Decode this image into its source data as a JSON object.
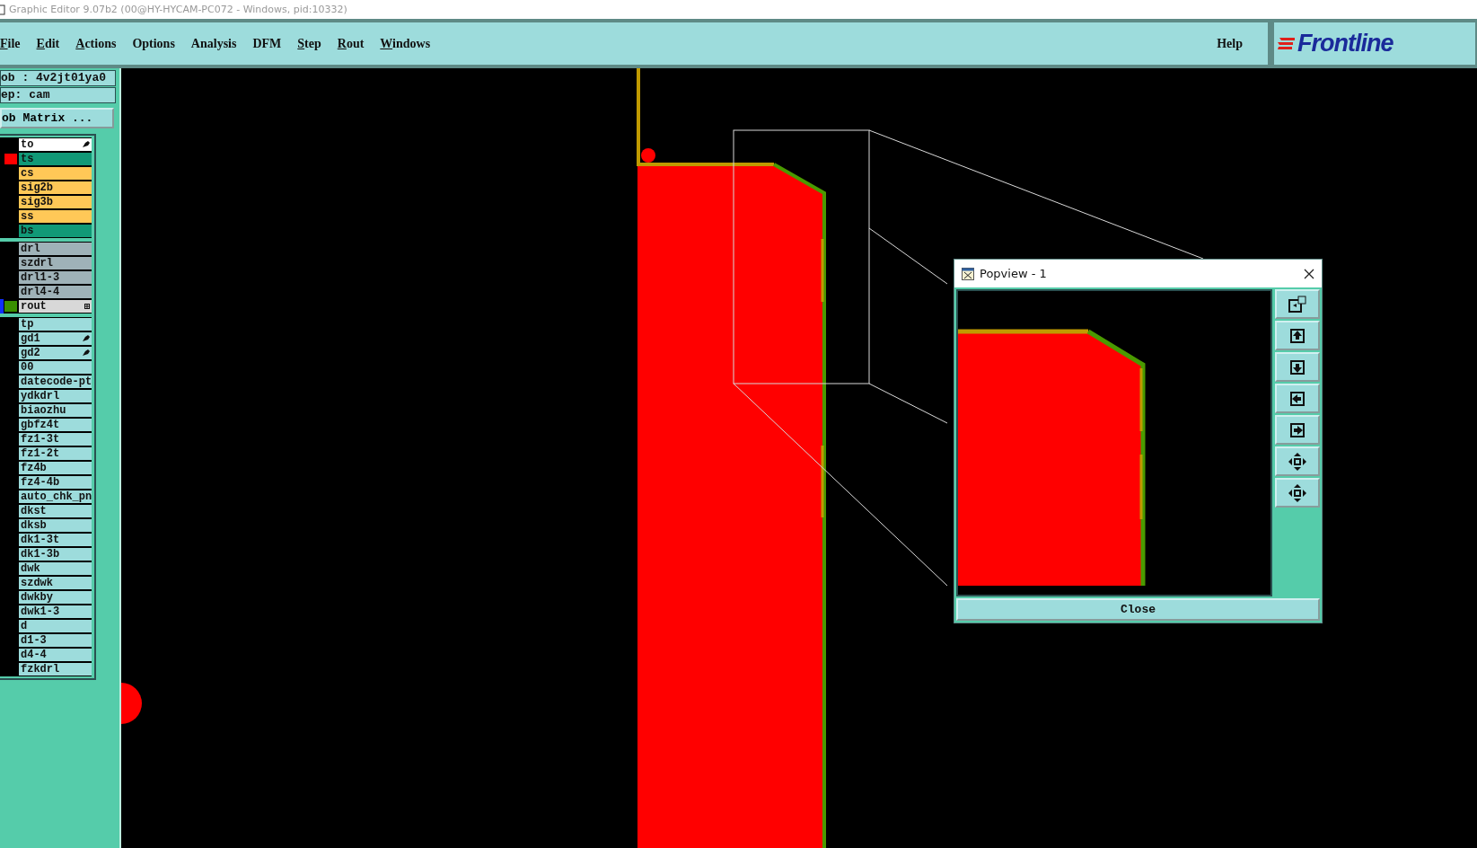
{
  "window": {
    "title": "Graphic Editor 9.07b2 (00@HY-HYCAM-PC072 - Windows, pid:10332)"
  },
  "menu": [
    {
      "label": "File",
      "underlined": true
    },
    {
      "label": "Edit",
      "underlined": true
    },
    {
      "label": "Actions",
      "underlined": true
    },
    {
      "label": "Options",
      "underlined": false
    },
    {
      "label": "Analysis",
      "underlined": false
    },
    {
      "label": "DFM",
      "underlined": false
    },
    {
      "label": "Step",
      "underlined": true
    },
    {
      "label": "Rout",
      "underlined": true
    },
    {
      "label": "Windows",
      "underlined": true
    }
  ],
  "help": "Help",
  "logo": "Frontline",
  "job": {
    "job": "ob : 4v2jt01ya0",
    "step": "ep: cam",
    "matrix_button": "ob Matrix ..."
  },
  "layer_groups": [
    {
      "layers": [
        {
          "name": "to",
          "kind": "mask",
          "selected": true,
          "work": false,
          "marked": true
        },
        {
          "name": "ts",
          "kind": "mask",
          "selected": false,
          "work": false,
          "marked": false,
          "color": "#ff0000"
        },
        {
          "name": "cs",
          "kind": "signal",
          "selected": false,
          "work": false,
          "marked": false
        },
        {
          "name": "sig2b",
          "kind": "signal",
          "selected": false,
          "work": false,
          "marked": false
        },
        {
          "name": "sig3b",
          "kind": "signal",
          "selected": false,
          "work": false,
          "marked": false
        },
        {
          "name": "ss",
          "kind": "signal",
          "selected": false,
          "work": false,
          "marked": false
        },
        {
          "name": "bs",
          "kind": "mask",
          "selected": false,
          "work": false,
          "marked": false
        }
      ]
    },
    {
      "layers": [
        {
          "name": "drl",
          "kind": "drill",
          "selected": false,
          "work": false,
          "marked": false
        },
        {
          "name": "szdrl",
          "kind": "drill",
          "selected": false,
          "work": false,
          "marked": false
        },
        {
          "name": "drl1-3",
          "kind": "drill",
          "selected": false,
          "work": false,
          "marked": false
        },
        {
          "name": "drl4-4",
          "kind": "drill",
          "selected": false,
          "work": false,
          "marked": false
        },
        {
          "name": "rout",
          "kind": "rout",
          "selected": false,
          "work": true,
          "marked": false,
          "color": "#3a8f00"
        }
      ]
    },
    {
      "layers": [
        {
          "name": "tp",
          "kind": "misc",
          "selected": false,
          "work": false,
          "marked": false
        },
        {
          "name": "gd1",
          "kind": "misc",
          "selected": false,
          "work": false,
          "marked": true
        },
        {
          "name": "gd2",
          "kind": "misc",
          "selected": false,
          "work": false,
          "marked": true
        },
        {
          "name": "00",
          "kind": "misc",
          "selected": false,
          "work": false,
          "marked": false
        },
        {
          "name": "datecode-pt",
          "kind": "misc",
          "selected": false,
          "work": false,
          "marked": false
        },
        {
          "name": "ydkdrl",
          "kind": "misc",
          "selected": false,
          "work": false,
          "marked": false
        },
        {
          "name": "biaozhu",
          "kind": "misc",
          "selected": false,
          "work": false,
          "marked": false
        },
        {
          "name": "gbfz4t",
          "kind": "misc",
          "selected": false,
          "work": false,
          "marked": false
        },
        {
          "name": "fz1-3t",
          "kind": "misc",
          "selected": false,
          "work": false,
          "marked": false
        },
        {
          "name": "fz1-2t",
          "kind": "misc",
          "selected": false,
          "work": false,
          "marked": false
        },
        {
          "name": "fz4b",
          "kind": "misc",
          "selected": false,
          "work": false,
          "marked": false
        },
        {
          "name": "fz4-4b",
          "kind": "misc",
          "selected": false,
          "work": false,
          "marked": false
        },
        {
          "name": "auto_chk_pn",
          "kind": "misc",
          "selected": false,
          "work": false,
          "marked": false
        },
        {
          "name": "dkst",
          "kind": "misc",
          "selected": false,
          "work": false,
          "marked": false
        },
        {
          "name": "dksb",
          "kind": "misc",
          "selected": false,
          "work": false,
          "marked": false
        },
        {
          "name": "dk1-3t",
          "kind": "misc",
          "selected": false,
          "work": false,
          "marked": false
        },
        {
          "name": "dk1-3b",
          "kind": "misc",
          "selected": false,
          "work": false,
          "marked": false
        },
        {
          "name": "dwk",
          "kind": "misc",
          "selected": false,
          "work": false,
          "marked": false
        },
        {
          "name": "szdwk",
          "kind": "misc",
          "selected": false,
          "work": false,
          "marked": false
        },
        {
          "name": "dwkby",
          "kind": "misc",
          "selected": false,
          "work": false,
          "marked": false
        },
        {
          "name": "dwk1-3",
          "kind": "misc",
          "selected": false,
          "work": false,
          "marked": false
        },
        {
          "name": "d",
          "kind": "misc",
          "selected": false,
          "work": false,
          "marked": false
        },
        {
          "name": "d1-3",
          "kind": "misc",
          "selected": false,
          "work": false,
          "marked": false
        },
        {
          "name": "d4-4",
          "kind": "misc",
          "selected": false,
          "work": false,
          "marked": false
        },
        {
          "name": "fzkdrl",
          "kind": "misc",
          "selected": false,
          "work": false,
          "marked": false
        }
      ]
    }
  ],
  "popview": {
    "title": "Popview - 1",
    "close_button": "Close"
  }
}
